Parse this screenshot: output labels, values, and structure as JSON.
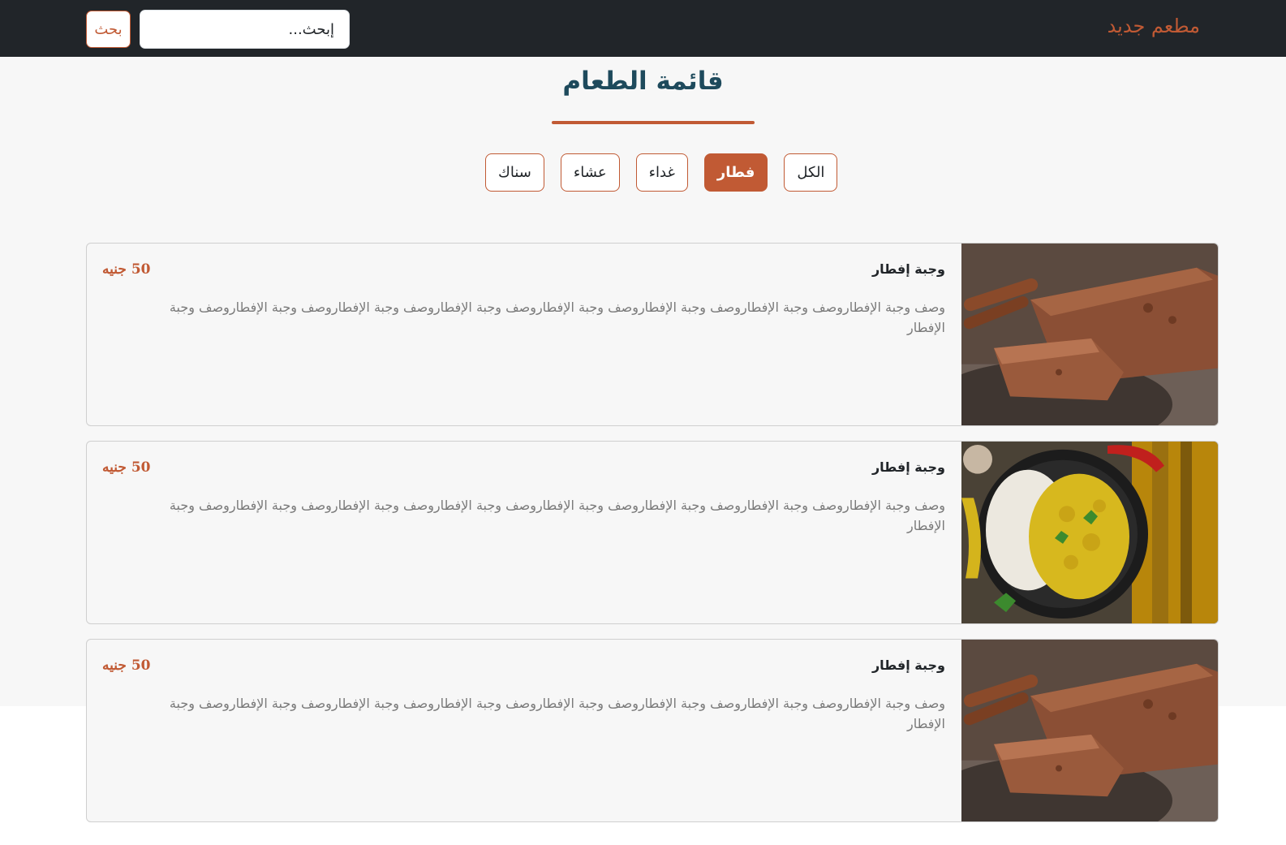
{
  "navbar": {
    "brand": "مطعم جديد",
    "search_placeholder": "إبحث...",
    "search_value": "",
    "search_button": "بحث"
  },
  "main": {
    "title": "قائمة الطعام",
    "filters": [
      {
        "label": "الكل",
        "active": false
      },
      {
        "label": "فطار",
        "active": true
      },
      {
        "label": "غداء",
        "active": false
      },
      {
        "label": "عشاء",
        "active": false
      },
      {
        "label": "سناك",
        "active": false
      }
    ]
  },
  "items": [
    {
      "title": "وجبة إفطار",
      "price": "50 جنيه",
      "description": "وصف وجبة الإفطاروصف وجبة الإفطاروصف وجبة الإفطاروصف وجبة الإفطاروصف وجبة الإفطاروصف وجبة الإفطاروصف وجبة الإفطاروصف وجبة الإفطار",
      "image": "bread-image"
    },
    {
      "title": "وجبة إفطار",
      "price": "50 جنيه",
      "description": "وصف وجبة الإفطاروصف وجبة الإفطاروصف وجبة الإفطاروصف وجبة الإفطاروصف وجبة الإفطاروصف وجبة الإفطاروصف وجبة الإفطاروصف وجبة الإفطار",
      "image": "curry-rice-image"
    },
    {
      "title": "وجبة إفطار",
      "price": "50 جنيه",
      "description": "وصف وجبة الإفطاروصف وجبة الإفطاروصف وجبة الإفطاروصف وجبة الإفطاروصف وجبة الإفطاروصف وجبة الإفطاروصف وجبة الإفطاروصف وجبة الإفطار",
      "image": "bread-image"
    }
  ],
  "colors": {
    "accent": "#c15a34",
    "navbar": "#212529",
    "title": "#1e4a5c"
  }
}
